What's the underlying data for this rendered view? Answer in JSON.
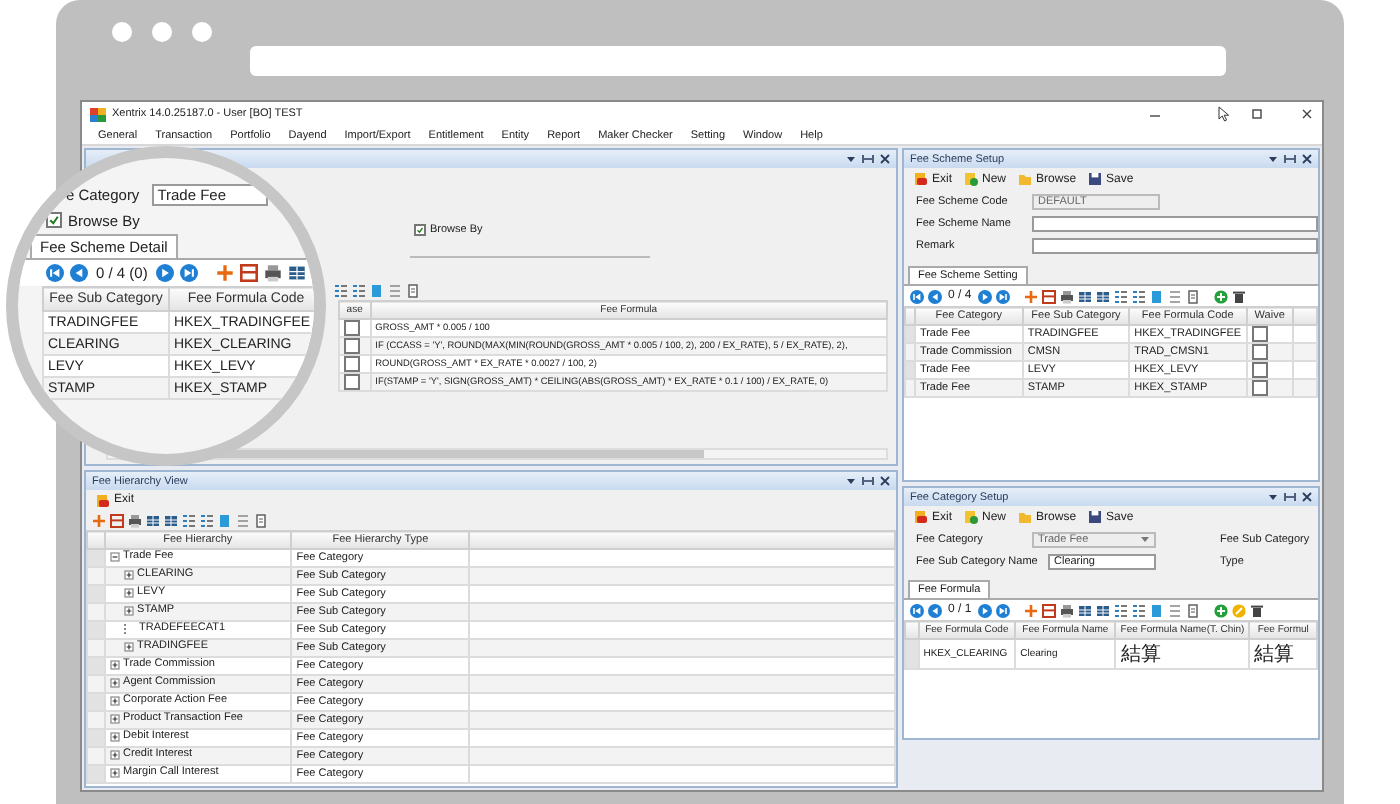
{
  "window": {
    "title": "Xentrix 14.0.25187.0 - User [BO] TEST"
  },
  "menu": [
    "General",
    "Transaction",
    "Portfolio",
    "Dayend",
    "Import/Export",
    "Entitlement",
    "Entity",
    "Report",
    "Maker Checker",
    "Setting",
    "Window",
    "Help"
  ],
  "fee_scheme_detail": {
    "browse_by": {
      "label": "Browse By",
      "checked": true
    },
    "columns": [
      "ase",
      "Fee Formula"
    ],
    "rows": [
      {
        "waive": false,
        "formula": "GROSS_AMT * 0.005 / 100"
      },
      {
        "waive": false,
        "formula": "IF (CCASS = 'Y', ROUND(MAX(MIN(ROUND(GROSS_AMT * 0.005 / 100, 2), 200 / EX_RATE), 5 / EX_RATE), 2),"
      },
      {
        "waive": false,
        "formula": "ROUND(GROSS_AMT * EX_RATE * 0.0027 / 100, 2)"
      },
      {
        "waive": false,
        "formula": "IF(STAMP = 'Y', SIGN(GROSS_AMT) * CEILING(ABS(GROSS_AMT) * EX_RATE * 0.1 / 100) / EX_RATE, 0)"
      }
    ]
  },
  "magnifier": {
    "category_label": "e Category",
    "category_value": "Trade Fee",
    "browse_by": {
      "label": "Browse By",
      "checked": true
    },
    "tab": "Fee Scheme Detail",
    "pager": "0 / 4 (0)",
    "columns": [
      "Fee Sub Category",
      "Fee Formula Code"
    ],
    "rows": [
      [
        "TRADINGFEE",
        "HKEX_TRADINGFEE"
      ],
      [
        "CLEARING",
        "HKEX_CLEARING"
      ],
      [
        "LEVY",
        "HKEX_LEVY"
      ],
      [
        "STAMP",
        "HKEX_STAMP"
      ]
    ]
  },
  "fee_scheme_setup": {
    "title": "Fee Scheme Setup",
    "toolbar": [
      {
        "label": "Exit",
        "kind": "exit"
      },
      {
        "label": "New",
        "kind": "new"
      },
      {
        "label": "Browse",
        "kind": "browse"
      },
      {
        "label": "Save",
        "kind": "save"
      }
    ],
    "fields": [
      {
        "label": "Fee Scheme Code",
        "value": "DEFAULT",
        "disabled": true
      },
      {
        "label": "Fee Scheme Name",
        "disabled": false
      },
      {
        "label": "Remark",
        "disabled": false
      }
    ],
    "tab": "Fee Scheme Setting",
    "pager": "0 / 4",
    "columns": [
      "Fee Category",
      "Fee Sub Category",
      "Fee Formula Code",
      "Waive"
    ],
    "rows": [
      {
        "category": "Trade Fee",
        "sub_category": "TRADINGFEE",
        "formula_code": "HKEX_TRADINGFEE",
        "waive": false
      },
      {
        "category": "Trade Commission",
        "sub_category": "CMSN",
        "formula_code": "TRAD_CMSN1",
        "waive": false
      },
      {
        "category": "Trade Fee",
        "sub_category": "LEVY",
        "formula_code": "HKEX_LEVY",
        "waive": false
      },
      {
        "category": "Trade Fee",
        "sub_category": "STAMP",
        "formula_code": "HKEX_STAMP",
        "waive": false
      }
    ]
  },
  "fee_hierarchy_view": {
    "title": "Fee Hierarchy View",
    "toolbar": [
      {
        "label": "Exit",
        "kind": "exit"
      }
    ],
    "columns": [
      "Fee Hierarchy",
      "Fee Hierarchy Type"
    ],
    "tree": [
      {
        "label": "Trade Fee",
        "type": "Fee Category",
        "kind": "branch",
        "expanded": true,
        "children": [
          {
            "label": "CLEARING",
            "type": "Fee Sub Category",
            "kind": "branch",
            "expanded": false
          },
          {
            "label": "LEVY",
            "type": "Fee Sub Category",
            "kind": "branch",
            "expanded": false
          },
          {
            "label": "STAMP",
            "type": "Fee Sub Category",
            "kind": "branch",
            "expanded": false
          },
          {
            "label": "TRADEFEECAT1",
            "type": "Fee Sub Category",
            "kind": "leaf"
          },
          {
            "label": "TRADINGFEE",
            "type": "Fee Sub Category",
            "kind": "branch",
            "expanded": false
          }
        ]
      },
      {
        "label": "Trade Commission",
        "type": "Fee Category",
        "kind": "branch",
        "expanded": false
      },
      {
        "label": "Agent Commission",
        "type": "Fee Category",
        "kind": "branch",
        "expanded": false
      },
      {
        "label": "Corporate Action Fee",
        "type": "Fee Category",
        "kind": "branch",
        "expanded": false
      },
      {
        "label": "Product Transaction Fee",
        "type": "Fee Category",
        "kind": "branch",
        "expanded": false
      },
      {
        "label": "Debit Interest",
        "type": "Fee Category",
        "kind": "branch",
        "expanded": false
      },
      {
        "label": "Credit Interest",
        "type": "Fee Category",
        "kind": "branch",
        "expanded": false
      },
      {
        "label": "Margin Call Interest",
        "type": "Fee Category",
        "kind": "branch",
        "expanded": false
      }
    ]
  },
  "fee_category_setup": {
    "title": "Fee Category Setup",
    "toolbar": [
      {
        "label": "Exit",
        "kind": "exit"
      },
      {
        "label": "New",
        "kind": "new"
      },
      {
        "label": "Browse",
        "kind": "browse"
      },
      {
        "label": "Save",
        "kind": "save"
      }
    ],
    "category": {
      "label": "Fee Category",
      "value": "Trade Fee",
      "disabled": true
    },
    "sub_category_label": "Fee Sub Category",
    "name": {
      "label": "Fee Sub Category Name",
      "value": "Clearing"
    },
    "type_label": "Type",
    "tab": "Fee Formula",
    "pager": "0 / 1",
    "columns": [
      "Fee Formula Code",
      "Fee Formula Name",
      "Fee Formula Name(T. Chin)",
      "Fee Formul"
    ],
    "rows": [
      [
        "HKEX_CLEARING",
        "Clearing",
        "結算",
        "結算"
      ]
    ]
  }
}
